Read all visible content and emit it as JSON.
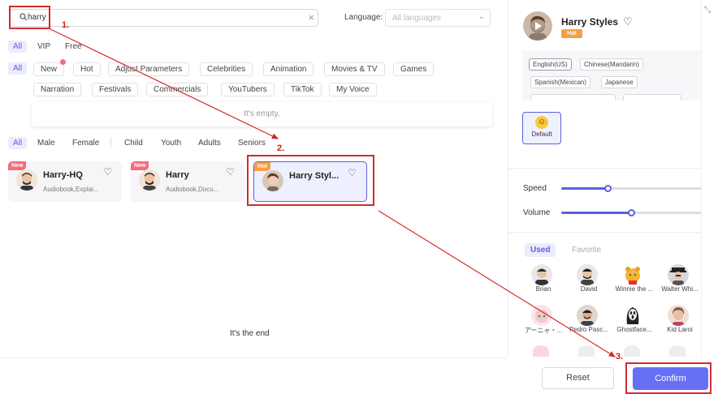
{
  "search": {
    "value": "harry"
  },
  "language": {
    "label": "Language:",
    "placeholder": "All languages"
  },
  "tier_tabs": [
    "All",
    "VIP",
    "Free"
  ],
  "category_all": "All",
  "categories_row1": [
    "New",
    "Hot",
    "Adjust Parameters",
    "Celebrities",
    "Animation",
    "Movies & TV",
    "Games"
  ],
  "categories_row2": [
    "Narration",
    "Festivals",
    "Commercials",
    "YouTubers",
    "TikTok",
    "My Voice"
  ],
  "empty_text": "It's empty.",
  "filter_tabs": [
    "All",
    "Male",
    "Female",
    "Child",
    "Youth",
    "Adults",
    "Seniors"
  ],
  "cards": [
    {
      "badge": "New",
      "name": "Harry-HQ",
      "desc": "Audiobook,Explai..."
    },
    {
      "badge": "New",
      "name": "Harry",
      "desc": "Audiobook,Docu..."
    },
    {
      "badge": "Hot",
      "name": "Harry Styl..."
    }
  ],
  "end_text": "It's the end",
  "steps": [
    "1.",
    "2.",
    "3."
  ],
  "right": {
    "name": "Harry Styles",
    "badge": "Hot",
    "languages": [
      "English(US)",
      "Chinese(Mandarin)",
      "Spanish(Mexican)",
      "Japanese"
    ],
    "default_label": "Default",
    "speed_label": "Speed",
    "volume_label": "Volume",
    "speed_value": 0.33,
    "volume_value": 0.5,
    "tabs": [
      "Used",
      "Favorite"
    ],
    "voices_row1": [
      "Brian",
      "David",
      "Winnie the ...",
      "Walter Whi..."
    ],
    "voices_row2": [
      "アーニャ・...",
      "Pedro Pasc...",
      "Ghostface...",
      "Kid Laroi"
    ]
  },
  "buttons": {
    "reset": "Reset",
    "confirm": "Confirm"
  },
  "colors": {
    "accent": "#5a5fdc",
    "confirm": "#6770f4",
    "hot": "#f69f44",
    "new": "#f56b7b",
    "annotation": "#d52a2a"
  }
}
